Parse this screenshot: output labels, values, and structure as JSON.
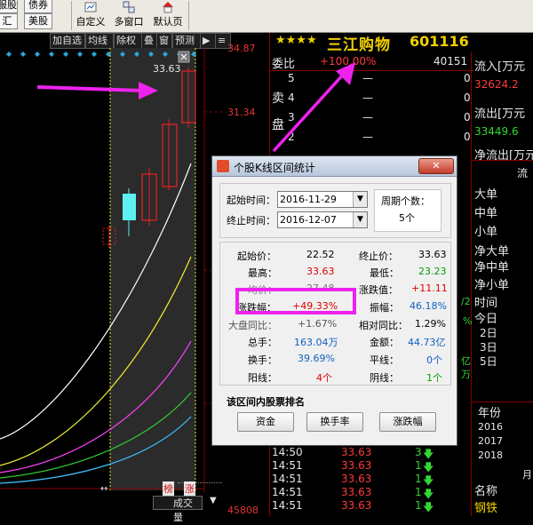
{
  "toolbar": {
    "left_buttons": [
      "服股",
      "债券",
      "汇",
      "美股"
    ],
    "big_buttons": [
      "自定义",
      "多窗口",
      "默认页"
    ]
  },
  "chart_tools": {
    "buttons": [
      "加自选",
      "均线",
      "除权",
      "叠",
      "窗",
      "预测"
    ]
  },
  "chart": {
    "price_top": "34.87",
    "price_mid": "31.34",
    "high_label": "33.63",
    "volume_label": "45808",
    "bottom_tag1": "榜",
    "bottom_tag2": "涨",
    "volume_dropdown": "成交量"
  },
  "stock": {
    "stars": "★★★★",
    "name": "三江购物",
    "code": "601116",
    "weibi_label": "委比",
    "weibi_value": "+100.00%",
    "weibi_count": "40151",
    "sell_label": "卖",
    "disk_label": "盘",
    "sell_levels": [
      "5",
      "4",
      "3",
      "2"
    ],
    "dash": "—",
    "zero": "0"
  },
  "flow": {
    "in_label": "流入[万元",
    "in_value": "32624.2",
    "out_label": "流出[万元",
    "out_value": "33449.6",
    "net_label": "净流出[万元",
    "side_label": "流",
    "big": "大单",
    "mid": "中单",
    "small": "小单",
    "net_big": "净大单",
    "net_mid": "净中单",
    "net_small": "净小单",
    "time_label": "时间",
    "today": "今日",
    "days": [
      "2日",
      "3日",
      "5日"
    ],
    "side_vals": [
      "/2",
      "%",
      "亿",
      "万"
    ]
  },
  "year_panel": {
    "header": "年份",
    "years": [
      "2016",
      "2017",
      "2018"
    ],
    "name_label": "名称",
    "name_value": "钢铁",
    "side": "月"
  },
  "ticks": [
    {
      "time": "14:50",
      "price": "33.63",
      "vol": "3"
    },
    {
      "time": "14:51",
      "price": "33.63",
      "vol": "1"
    },
    {
      "time": "14:51",
      "price": "33.63",
      "vol": "1"
    },
    {
      "time": "14:51",
      "price": "33.63",
      "vol": "1"
    },
    {
      "time": "14:51",
      "price": "33.63",
      "vol": "1"
    }
  ],
  "dialog": {
    "title": "个股K线区间统计",
    "start_label": "起始时间：",
    "start_value": "2016-11-29",
    "end_label": "终止时间：",
    "end_value": "2016-12-07",
    "period_label": "周期个数：",
    "period_value": "5个",
    "start_price_label": "起始价：",
    "start_price": "22.52",
    "end_price_label": "终止价：",
    "end_price": "33.63",
    "high_label": "最高：",
    "high": "33.63",
    "low_label": "最低：",
    "low": "23.23",
    "avg_label": "均价：",
    "avg": "27.48",
    "change_val_label": "涨跌值：",
    "change_val": "+11.11",
    "change_pct_label": "涨跌幅：",
    "change_pct": "+49.33%",
    "amplitude_label": "振幅：",
    "amplitude": "46.18%",
    "market_label": "大盘同比：",
    "market": "+1.67%",
    "vs_market_label": "相对同比：",
    "vs_market": "1.29%",
    "total_hand_label": "总手：",
    "total_hand": "163.04万",
    "amount_label": "金额：",
    "amount": "44.73亿",
    "turnover_label": "换手：",
    "turnover": "39.69%",
    "flat_label": "平线：",
    "flat": "0个",
    "yang_label": "阳线：",
    "yang": "4个",
    "yin_label": "阴线：",
    "yin": "1个",
    "rank_label": "该区间内股票排名",
    "btn_fund": "资金",
    "btn_turnover": "换手率",
    "btn_change": "涨跌幅"
  },
  "colors": {
    "annotation_magenta": "#ee22ee",
    "up_red": "#ff3a3a",
    "down_cyan": "#5ef0f0",
    "bg": "#000000"
  }
}
